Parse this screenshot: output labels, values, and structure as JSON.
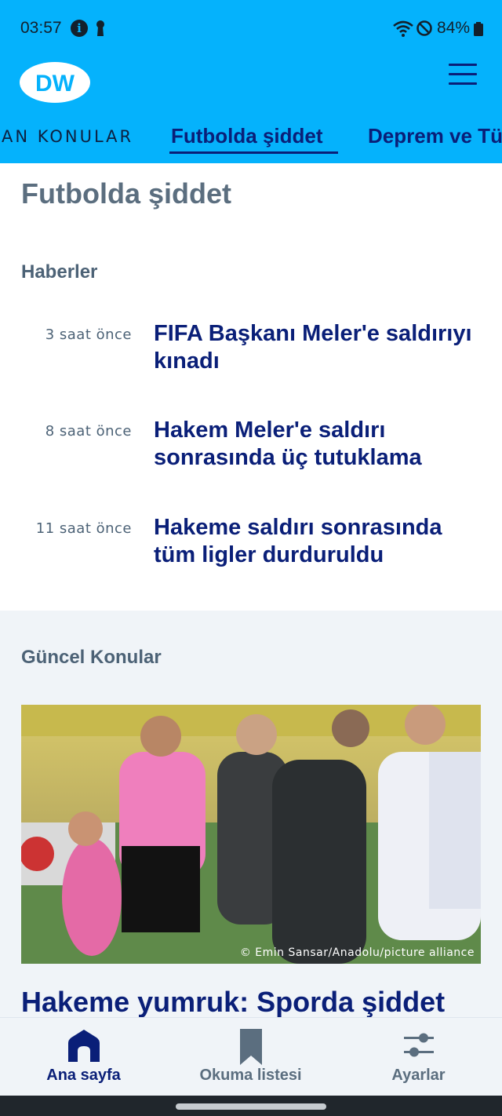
{
  "status_bar": {
    "time": "03:57",
    "battery": "84%"
  },
  "header": {
    "logo_text": "DW",
    "menu_icon": "hamburger-icon",
    "topics": [
      {
        "label": "AN KONULAR"
      },
      {
        "label": "Futbolda şiddet",
        "active": true
      },
      {
        "label": "Deprem ve Tü"
      }
    ]
  },
  "page": {
    "title": "Futbolda şiddet",
    "news_section": "Haberler",
    "news": [
      {
        "time": "3 saat önce",
        "title": "FIFA Başkanı Meler'e saldırıyı kınadı"
      },
      {
        "time": "8 saat önce",
        "title": "Hakem Meler'e saldırı sonrasında üç tutuklama"
      },
      {
        "time": "11 saat önce",
        "title": "Hakeme saldırı sonrasında tüm ligler durduruldu"
      }
    ],
    "current_section": "Güncel Konular",
    "hero_credit": "© Emin Sansar/Anadolu/picture alliance",
    "headline": "Hakeme yumruk: Sporda şiddet"
  },
  "bottom_nav": {
    "items": [
      {
        "label": "Ana sayfa",
        "icon": "home-icon",
        "active": true
      },
      {
        "label": "Okuma listesi",
        "icon": "bookmark-icon"
      },
      {
        "label": "Ayarlar",
        "icon": "sliders-icon"
      }
    ]
  },
  "colors": {
    "header_bg": "#05b2fc",
    "brand_navy": "#0a1f78",
    "muted_text": "#5b6e7f",
    "section_bg": "#f0f4f8"
  }
}
